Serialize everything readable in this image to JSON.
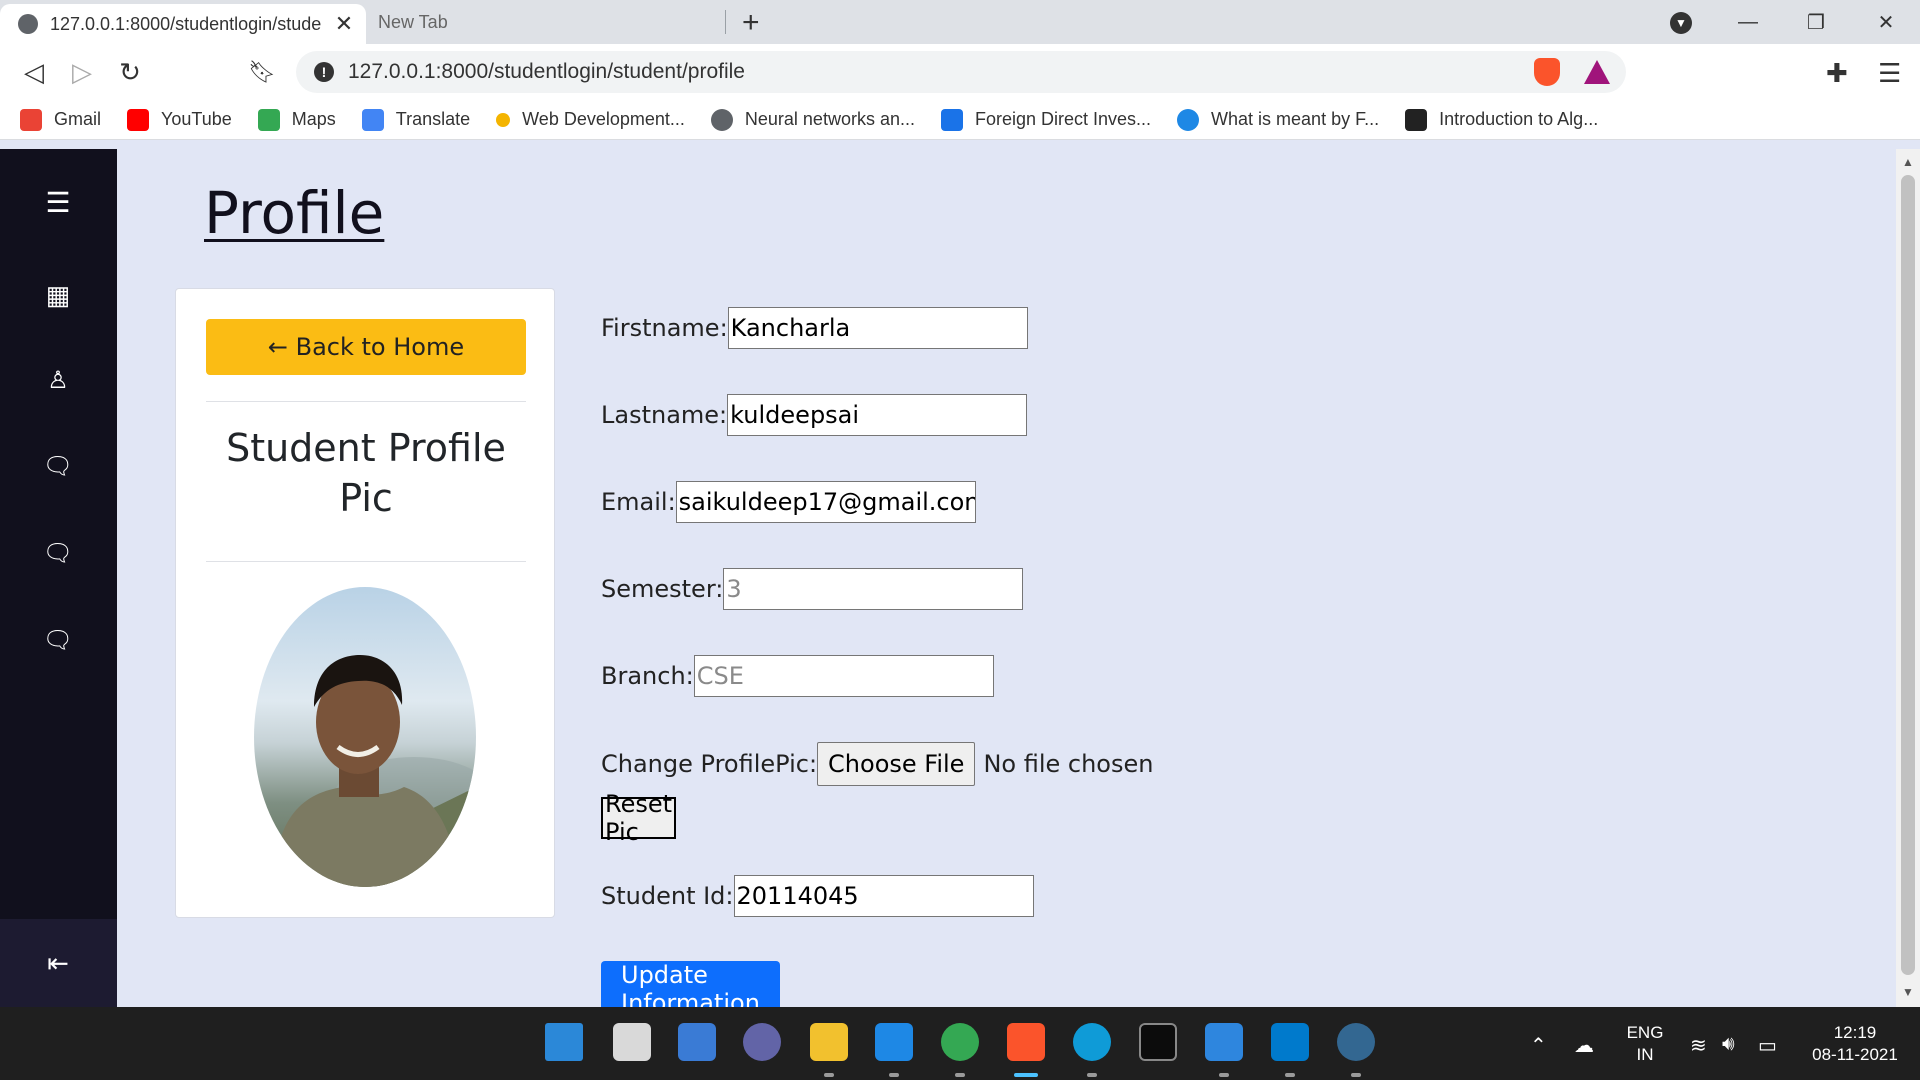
{
  "browser": {
    "tabs": [
      {
        "title": "127.0.0.1:8000/studentlogin/stude",
        "active": true
      },
      {
        "title": "New Tab",
        "active": false
      }
    ],
    "new_tab_icon": "+",
    "address": "127.0.0.1:8000/studentlogin/student/profile",
    "bookmarks": [
      {
        "label": "Gmail",
        "icon": "gmail-icon",
        "color": "#ea4335"
      },
      {
        "label": "YouTube",
        "icon": "youtube-icon",
        "color": "#ff0000"
      },
      {
        "label": "Maps",
        "icon": "maps-icon",
        "color": "#34a853"
      },
      {
        "label": "Translate",
        "icon": "translate-icon",
        "color": "#4285f4"
      },
      {
        "label": "Web Development...",
        "icon": "web-dev-icon",
        "color": "#f4b400"
      },
      {
        "label": "Neural networks an...",
        "icon": "globe-icon",
        "color": "#5f6368"
      },
      {
        "label": "Foreign Direct Inves...",
        "icon": "b-icon",
        "color": "#1a73e8"
      },
      {
        "label": "What is meant by F...",
        "icon": "e-icon",
        "color": "#1e88e5"
      },
      {
        "label": "Introduction to Alg...",
        "icon": "book-icon",
        "color": "#222222"
      }
    ]
  },
  "page": {
    "title": "Profile",
    "back_button": "← Back to Home",
    "card_heading": "Student Profile Pic",
    "form": {
      "firstname_label": "Firstname:",
      "firstname_value": "Kancharla",
      "lastname_label": "Lastname:",
      "lastname_value": "kuldeepsai",
      "email_label": "Email:",
      "email_value": "saikuldeep17@gmail.con",
      "semester_label": "Semester:",
      "semester_placeholder": "3",
      "branch_label": "Branch:",
      "branch_placeholder": "CSE",
      "profilepic_label": "Change ProfilePic:",
      "choose_file_button": "Choose File",
      "no_file_text": "No file chosen",
      "reset_button": "Reset Pic",
      "student_id_label": "Student Id:",
      "student_id_value": "20114045",
      "update_button": "Update Information"
    }
  },
  "taskbar": {
    "language": "ENG",
    "region": "IN",
    "time": "12:19",
    "date": "08-11-2021"
  },
  "colors": {
    "sidebar": "#11101d",
    "page_bg": "#e1e6f5",
    "back_button": "#fbbc14",
    "update_button": "#0d6efd"
  }
}
